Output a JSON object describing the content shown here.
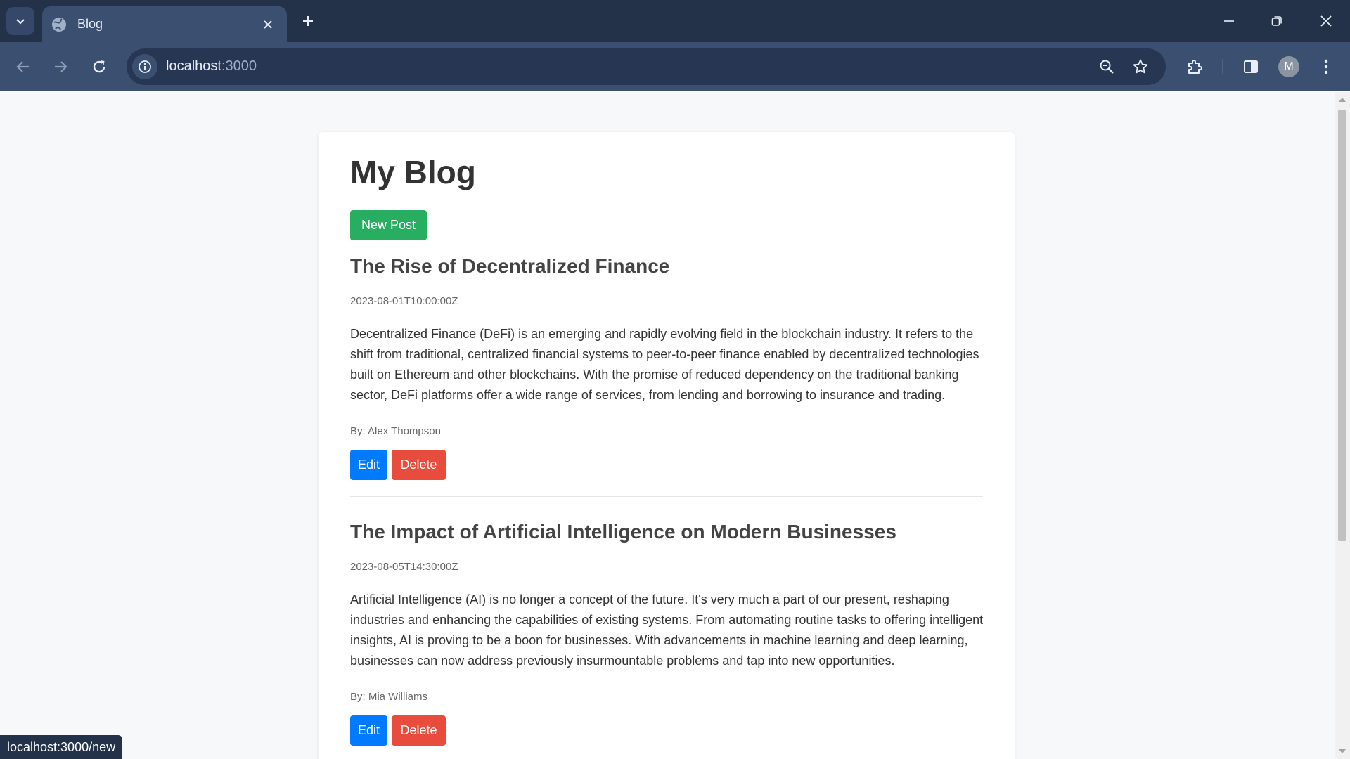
{
  "browser": {
    "tab_title": "Blog",
    "url_host": "localhost",
    "url_port": ":3000",
    "profile_initial": "M",
    "status_url": "localhost:3000/new"
  },
  "page": {
    "title": "My Blog",
    "new_post_label": "New Post",
    "posts": [
      {
        "title": "The Rise of Decentralized Finance",
        "date": "2023-08-01T10:00:00Z",
        "body": "Decentralized Finance (DeFi) is an emerging and rapidly evolving field in the blockchain industry. It refers to the shift from traditional, centralized financial systems to peer-to-peer finance enabled by decentralized technologies built on Ethereum and other blockchains. With the promise of reduced dependency on the traditional banking sector, DeFi platforms offer a wide range of services, from lending and borrowing to insurance and trading.",
        "author": "By: Alex Thompson",
        "edit_label": "Edit",
        "delete_label": "Delete"
      },
      {
        "title": "The Impact of Artificial Intelligence on Modern Businesses",
        "date": "2023-08-05T14:30:00Z",
        "body": "Artificial Intelligence (AI) is no longer a concept of the future. It's very much a part of our present, reshaping industries and enhancing the capabilities of existing systems. From automating routine tasks to offering intelligent insights, AI is proving to be a boon for businesses. With advancements in machine learning and deep learning, businesses can now address previously insurmountable problems and tap into new opportunities.",
        "author": "By: Mia Williams",
        "edit_label": "Edit",
        "delete_label": "Delete"
      }
    ]
  },
  "colors": {
    "new_post_button": "#27ae60",
    "edit_button": "#007bff",
    "delete_button": "#e74c3c",
    "chrome_frame": "#233249",
    "chrome_toolbar": "#3b5071"
  },
  "icons": {
    "tab_search": "chevron-down-icon",
    "favicon": "globe-icon",
    "tab_close": "close-icon",
    "new_tab": "plus-icon",
    "back": "arrow-left-icon",
    "forward": "arrow-right-icon",
    "reload": "reload-icon",
    "site_info": "info-icon",
    "zoom": "zoom-out-icon",
    "bookmark": "star-icon",
    "extensions": "puzzle-icon",
    "side_panel": "side-panel-icon",
    "menu": "kebab-menu-icon"
  }
}
